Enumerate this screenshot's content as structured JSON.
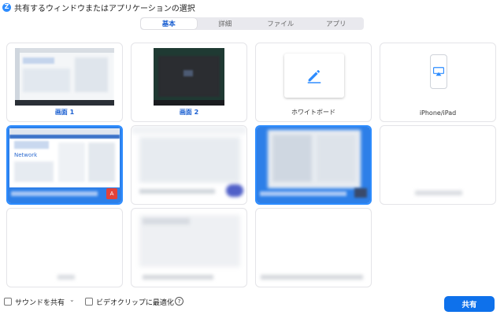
{
  "window": {
    "title": "共有するウィンドウまたはアプリケーションの選択",
    "app_icon_letter": "Z"
  },
  "tabs": [
    {
      "label": "基本",
      "active": true
    },
    {
      "label": "詳細",
      "active": false
    },
    {
      "label": "ファイル",
      "active": false
    },
    {
      "label": "アプリ",
      "active": false
    }
  ],
  "cards": [
    {
      "label": "画面 1"
    },
    {
      "label": "画面 2"
    },
    {
      "label": "ホワイトボード",
      "icon": "pencil-icon"
    },
    {
      "label": "iPhone/iPad",
      "icon": "airplay-icon"
    },
    {
      "label": "",
      "selected": true,
      "app": "Adobe Acrobat"
    },
    {
      "label": ""
    },
    {
      "label": "",
      "selected": true
    },
    {
      "label": ""
    },
    {
      "label": ""
    },
    {
      "label": ""
    },
    {
      "label": ""
    }
  ],
  "thumbnail_text": {
    "network": "Network"
  },
  "bottom": {
    "sound_label": "サウンドを共有",
    "video_label": "ビデオクリップに最適化",
    "help": "?",
    "share_label": "共有"
  },
  "colors": {
    "accent": "#2d8cff",
    "share_button": "#0e71eb",
    "active_tab_text": "#1a5fd1"
  }
}
